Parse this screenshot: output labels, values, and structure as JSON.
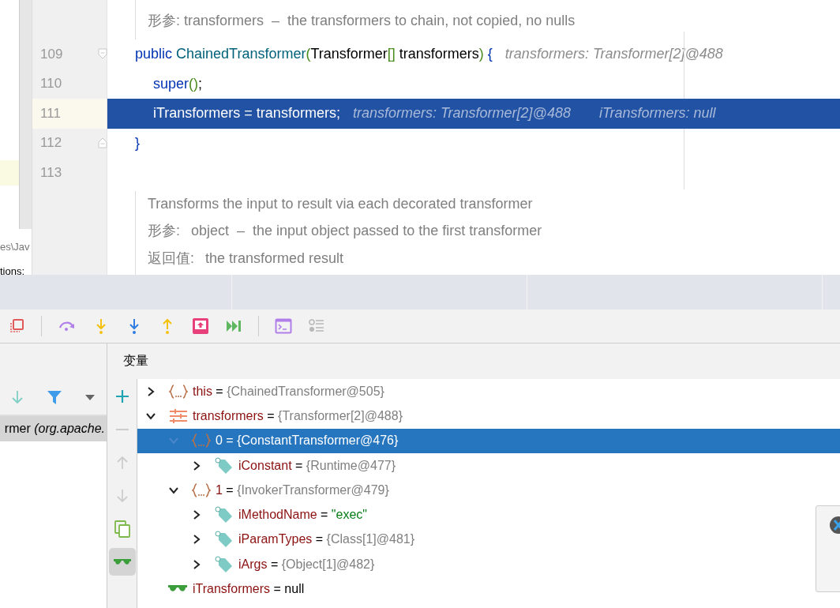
{
  "sidebar": {
    "fragments": [
      "es\\Jav",
      "tions:"
    ]
  },
  "doc_top": {
    "lines": [
      {
        "label": "形参:",
        "text": "transformers  –  the transformers to chain, not copied, no nulls"
      }
    ]
  },
  "code_lines": [
    {
      "number": "109",
      "current": false,
      "fold_start": true,
      "indent": false,
      "tokens": [
        {
          "kind": "keyword",
          "text": "public "
        },
        {
          "kind": "method",
          "text": "ChainedTransformer"
        },
        {
          "kind": "bracket",
          "text": "("
        },
        {
          "kind": "plain",
          "text": "Transformer"
        },
        {
          "kind": "bracket",
          "text": "[]"
        },
        {
          "kind": "plain",
          "text": " transformers"
        },
        {
          "kind": "bracket",
          "text": ")"
        },
        {
          "kind": "keyword",
          "text": " {"
        }
      ],
      "hints": [
        "transformers: Transformer[2]@488"
      ]
    },
    {
      "number": "110",
      "current": false,
      "indent": true,
      "tokens": [
        {
          "kind": "keyword",
          "text": "super"
        },
        {
          "kind": "bracket",
          "text": "()"
        },
        {
          "kind": "plain",
          "text": ";"
        }
      ]
    },
    {
      "number": "111",
      "current": true,
      "indent": true,
      "tokens": [
        {
          "kind": "plain",
          "text": "iTransformers = transformers;"
        }
      ],
      "hints": [
        "transformers: Transformer[2]@488",
        "iTransformers: null"
      ]
    },
    {
      "number": "112",
      "current": false,
      "fold_end": true,
      "indent": false,
      "tokens": [
        {
          "kind": "keyword",
          "text": "}"
        }
      ]
    },
    {
      "number": "113",
      "current": false
    }
  ],
  "doc_bottom": {
    "lines": [
      {
        "text": "Transforms the input to result via each decorated transformer"
      },
      {
        "label": "形参:",
        "text": "object  –  the input object passed to the first transformer"
      },
      {
        "label": "返回值:",
        "text": "the transformed result"
      }
    ]
  },
  "frames": [
    {
      "method": "rmer",
      "location": "(org.apache.",
      "selected": true
    }
  ],
  "side_toolbar": [
    {
      "kind": "add",
      "disabled": false,
      "selected": false
    },
    {
      "kind": "remove",
      "disabled": true,
      "selected": false
    },
    {
      "kind": "up",
      "disabled": true,
      "selected": false
    },
    {
      "kind": "down",
      "disabled": true,
      "selected": false
    },
    {
      "kind": "copy",
      "disabled": false,
      "selected": false
    },
    {
      "kind": "watches",
      "disabled": false,
      "selected": true
    }
  ],
  "variables": {
    "title": "变量",
    "tree": [
      {
        "kind": "object",
        "name": "this",
        "sign": "=",
        "value": {
          "kind": "ref",
          "text": "{ChainedTransformer@505}"
        },
        "expanded": false,
        "selected": false
      },
      {
        "kind": "array",
        "name": "transformers",
        "sign": "=",
        "value": {
          "kind": "ref",
          "text": "{Transformer[2]@488}"
        },
        "expanded": true,
        "selected": false,
        "children": [
          {
            "kind": "object",
            "name": "0",
            "sign": "=",
            "value": {
              "kind": "ref",
              "text": "{ConstantTransformer@476}"
            },
            "expanded": true,
            "selected": true,
            "children": [
              {
                "kind": "field",
                "name": "iConstant",
                "sign": "=",
                "value": {
                  "kind": "ref",
                  "text": "{Runtime@477}"
                },
                "expanded": false,
                "selected": false
              }
            ]
          },
          {
            "kind": "object",
            "name": "1",
            "sign": "=",
            "value": {
              "kind": "ref",
              "text": "{InvokerTransformer@479}"
            },
            "expanded": true,
            "selected": false,
            "children": [
              {
                "kind": "field",
                "name": "iMethodName",
                "sign": "=",
                "value": {
                  "kind": "string",
                  "text": "\"exec\""
                },
                "expanded": false,
                "selected": false
              },
              {
                "kind": "field",
                "name": "iParamTypes",
                "sign": "=",
                "value": {
                  "kind": "ref",
                  "text": "{Class[1]@481}"
                },
                "expanded": false,
                "selected": false
              },
              {
                "kind": "field",
                "name": "iArgs",
                "sign": "=",
                "value": {
                  "kind": "ref",
                  "text": "{Object[1]@482}"
                },
                "expanded": false,
                "selected": false
              }
            ]
          }
        ]
      },
      {
        "kind": "watch",
        "name": "iTransformers",
        "sign": "=",
        "value": {
          "kind": "plain",
          "text": "null"
        },
        "selected": false
      }
    ]
  }
}
